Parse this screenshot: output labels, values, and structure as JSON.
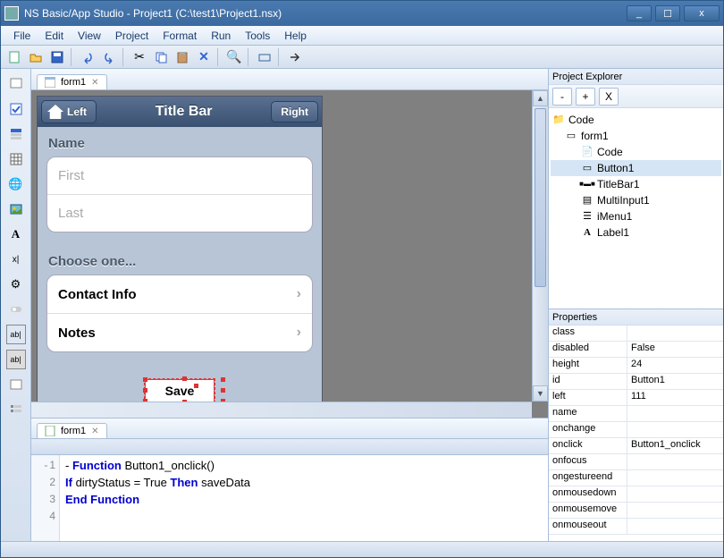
{
  "window": {
    "title": "NS Basic/App Studio - Project1 (C:\\test1\\Project1.nsx)"
  },
  "menu": [
    "File",
    "Edit",
    "View",
    "Project",
    "Format",
    "Run",
    "Tools",
    "Help"
  ],
  "designer": {
    "tab": "form1",
    "titlebar": {
      "left": "Left",
      "center": "Title Bar",
      "right": "Right"
    },
    "section1_label": "Name",
    "input_first": "First",
    "input_last": "Last",
    "section2_label": "Choose one...",
    "menu_contact": "Contact Info",
    "menu_notes": "Notes",
    "save_label": "Save"
  },
  "code": {
    "tab": "form1",
    "lines": [
      {
        "n": "1",
        "pre": "- ",
        "kw1": "Function",
        "mid": " Button1_onclick()"
      },
      {
        "n": "2",
        "pre": "   ",
        "kw1": "If",
        "mid": " dirtyStatus = True ",
        "kw2": "Then",
        "tail": " saveData"
      },
      {
        "n": "3",
        "pre": "  ",
        "kw1": "End Function",
        "mid": ""
      },
      {
        "n": "4",
        "pre": "",
        "kw1": "",
        "mid": ""
      }
    ]
  },
  "explorer": {
    "title": "Project Explorer",
    "btn_minus": "-",
    "btn_plus": "+",
    "btn_x": "X",
    "nodes": {
      "code": "Code",
      "form1": "form1",
      "form1_code": "Code",
      "button1": "Button1",
      "titlebar1": "TitleBar1",
      "multiinput1": "MultiInput1",
      "imenu1": "iMenu1",
      "label1": "Label1"
    }
  },
  "properties": {
    "title": "Properties",
    "rows": [
      {
        "k": "class",
        "v": ""
      },
      {
        "k": "disabled",
        "v": "False"
      },
      {
        "k": "height",
        "v": "24"
      },
      {
        "k": "id",
        "v": "Button1"
      },
      {
        "k": "left",
        "v": "111"
      },
      {
        "k": "name",
        "v": ""
      },
      {
        "k": "onchange",
        "v": ""
      },
      {
        "k": "onclick",
        "v": "Button1_onclick"
      },
      {
        "k": "onfocus",
        "v": ""
      },
      {
        "k": "ongestureend",
        "v": ""
      },
      {
        "k": "onmousedown",
        "v": ""
      },
      {
        "k": "onmousemove",
        "v": ""
      },
      {
        "k": "onmouseout",
        "v": ""
      }
    ]
  }
}
